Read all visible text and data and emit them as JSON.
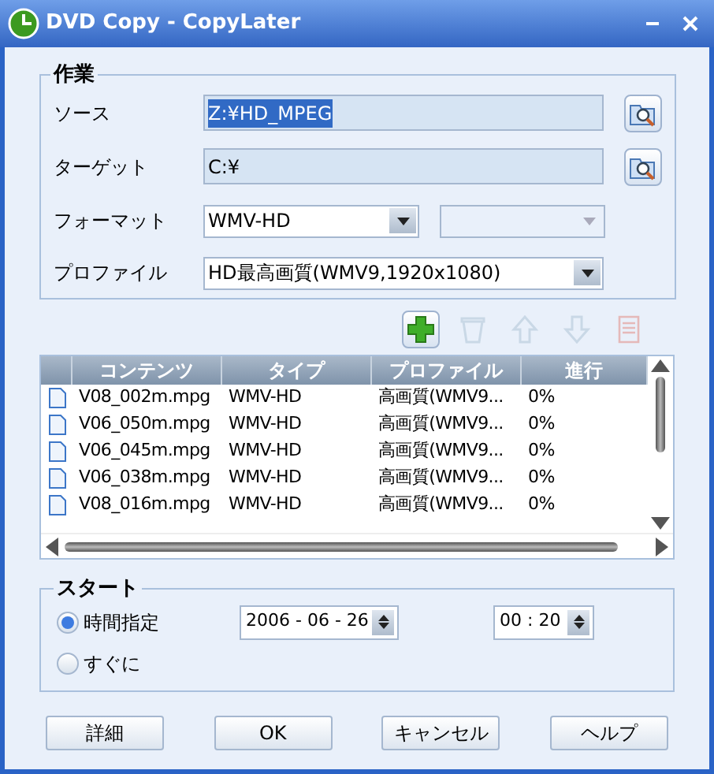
{
  "window": {
    "title": "DVD Copy - CopyLater"
  },
  "task": {
    "title": "作業",
    "source": {
      "label": "ソース",
      "value": "Z:¥HD_MPEG",
      "selected": true
    },
    "target": {
      "label": "ターゲット",
      "value": "C:¥",
      "selected": false
    },
    "format": {
      "label": "フォーマット",
      "value": "WMV-HD",
      "sub_disabled": true
    },
    "profile": {
      "label": "プロファイル",
      "value": "HD最高画質(WMV9,1920x1080)"
    }
  },
  "toolbar": [
    {
      "kind": "add",
      "disabled": false
    },
    {
      "kind": "delete",
      "disabled": true
    },
    {
      "kind": "up",
      "disabled": true
    },
    {
      "kind": "down",
      "disabled": true
    },
    {
      "kind": "properties",
      "disabled": true
    }
  ],
  "table": {
    "columns": [
      "コンテンツ",
      "タイプ",
      "プロファイル",
      "進行"
    ],
    "rows": [
      [
        "V08_002m.mpg",
        "WMV-HD",
        "高画質(WMV9...",
        "0%"
      ],
      [
        "V06_050m.mpg",
        "WMV-HD",
        "高画質(WMV9...",
        "0%"
      ],
      [
        "V06_045m.mpg",
        "WMV-HD",
        "高画質(WMV9...",
        "0%"
      ],
      [
        "V06_038m.mpg",
        "WMV-HD",
        "高画質(WMV9...",
        "0%"
      ],
      [
        "V08_016m.mpg",
        "WMV-HD",
        "高画質(WMV9...",
        "0%"
      ]
    ]
  },
  "start": {
    "title": "スタート",
    "options": [
      {
        "label": "時間指定",
        "selected": true
      },
      {
        "label": "すぐに",
        "selected": false
      }
    ],
    "date": "2006 - 06 - 26",
    "time": "00 : 20"
  },
  "buttons": [
    "詳細",
    "OK",
    "キャンセル",
    "ヘルプ"
  ]
}
